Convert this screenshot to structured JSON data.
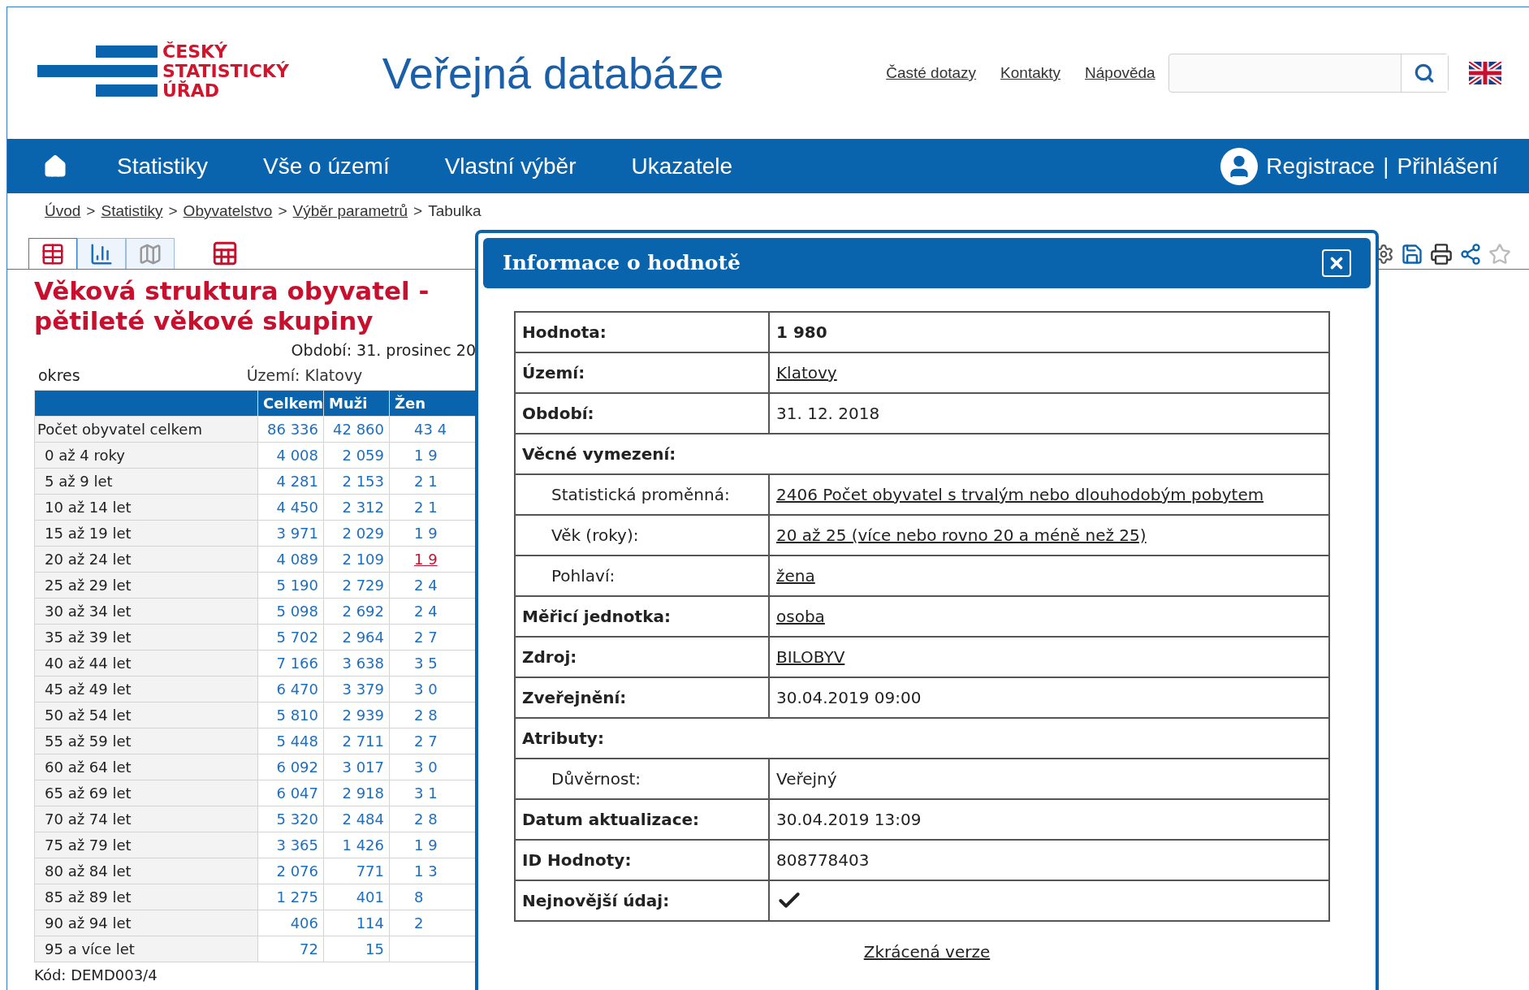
{
  "logo": {
    "lines": [
      "ČESKÝ",
      "STATISTICKÝ",
      "ÚŘAD"
    ]
  },
  "site_title": "Veřejná databáze",
  "top_links": [
    "Časté dotazy",
    "Kontakty",
    "Nápověda"
  ],
  "nav": {
    "items": [
      "Statistiky",
      "Vše o území",
      "Vlastní výběr",
      "Ukazatele"
    ],
    "account": [
      "Registrace",
      "Přihlášení"
    ],
    "account_separator": "|"
  },
  "breadcrumb": {
    "separator": ">",
    "items": [
      {
        "label": "Úvod",
        "link": true
      },
      {
        "label": "Statistiky",
        "link": true
      },
      {
        "label": "Obyvatelstvo",
        "link": true
      },
      {
        "label": "Výběr parametrů",
        "link": true
      },
      {
        "label": "Tabulka",
        "link": false
      }
    ]
  },
  "view_tabs": [
    {
      "kind": "table",
      "selected": true
    },
    {
      "kind": "chart",
      "selected": false
    },
    {
      "kind": "map",
      "selected": false
    }
  ],
  "report": {
    "title": "Věková struktura obyvatel - pětileté věkové skupiny",
    "period": "Období: 31. prosinec 20",
    "area_label": "okres",
    "area": "Území: Klatovy",
    "columns": [
      "Celkem",
      "Muži",
      "Žen"
    ],
    "rows": [
      {
        "label": "Počet obyvatel celkem",
        "celkem": "86 336",
        "muzi": "42 860",
        "zeny": "43 4",
        "selected": false
      },
      {
        "label": "0 až 4 roky",
        "celkem": "4 008",
        "muzi": "2 059",
        "zeny": "1 9",
        "selected": false
      },
      {
        "label": "5 až 9 let",
        "celkem": "4 281",
        "muzi": "2 153",
        "zeny": "2 1",
        "selected": false
      },
      {
        "label": "10 až 14 let",
        "celkem": "4 450",
        "muzi": "2 312",
        "zeny": "2 1",
        "selected": false
      },
      {
        "label": "15 až 19 let",
        "celkem": "3 971",
        "muzi": "2 029",
        "zeny": "1 9",
        "selected": false
      },
      {
        "label": "20 až 24 let",
        "celkem": "4 089",
        "muzi": "2 109",
        "zeny": "1 9",
        "selected": true
      },
      {
        "label": "25 až 29 let",
        "celkem": "5 190",
        "muzi": "2 729",
        "zeny": "2 4",
        "selected": false
      },
      {
        "label": "30 až 34 let",
        "celkem": "5 098",
        "muzi": "2 692",
        "zeny": "2 4",
        "selected": false
      },
      {
        "label": "35 až 39 let",
        "celkem": "5 702",
        "muzi": "2 964",
        "zeny": "2 7",
        "selected": false
      },
      {
        "label": "40 až 44 let",
        "celkem": "7 166",
        "muzi": "3 638",
        "zeny": "3 5",
        "selected": false
      },
      {
        "label": "45 až 49 let",
        "celkem": "6 470",
        "muzi": "3 379",
        "zeny": "3 0",
        "selected": false
      },
      {
        "label": "50 až 54 let",
        "celkem": "5 810",
        "muzi": "2 939",
        "zeny": "2 8",
        "selected": false
      },
      {
        "label": "55 až 59 let",
        "celkem": "5 448",
        "muzi": "2 711",
        "zeny": "2 7",
        "selected": false
      },
      {
        "label": "60 až 64 let",
        "celkem": "6 092",
        "muzi": "3 017",
        "zeny": "3 0",
        "selected": false
      },
      {
        "label": "65 až 69 let",
        "celkem": "6 047",
        "muzi": "2 918",
        "zeny": "3 1",
        "selected": false
      },
      {
        "label": "70 až 74 let",
        "celkem": "5 320",
        "muzi": "2 484",
        "zeny": "2 8",
        "selected": false
      },
      {
        "label": "75 až 79 let",
        "celkem": "3 365",
        "muzi": "1 426",
        "zeny": "1 9",
        "selected": false
      },
      {
        "label": "80 až 84 let",
        "celkem": "2 076",
        "muzi": "771",
        "zeny": "1 3",
        "selected": false
      },
      {
        "label": "85 až 89 let",
        "celkem": "1 275",
        "muzi": "401",
        "zeny": "8",
        "selected": false
      },
      {
        "label": "90 až 94 let",
        "celkem": "406",
        "muzi": "114",
        "zeny": "2",
        "selected": false
      },
      {
        "label": "95 a více let",
        "celkem": "72",
        "muzi": "15"
      }
    ],
    "code": "Kód: DEMD003/4"
  },
  "dialog": {
    "title": "Informace o hodnotě",
    "rows": [
      {
        "kind": "field",
        "label": "Hodnota:",
        "value": "1 980",
        "link": false,
        "bold": true
      },
      {
        "kind": "field",
        "label": "Území:",
        "value": "Klatovy",
        "link": true,
        "bold": false
      },
      {
        "kind": "field",
        "label": "Období:",
        "value": "31. 12. 2018",
        "link": false,
        "bold": false
      },
      {
        "kind": "section",
        "label": "Věcné vymezení:"
      },
      {
        "kind": "sub",
        "label": "Statistická proměnná:",
        "value": "2406 Počet obyvatel s trvalým nebo dlouhodobým pobytem",
        "link": true,
        "bold": false
      },
      {
        "kind": "sub",
        "label": "Věk (roky):",
        "value": "20 až 25 (více nebo rovno 20 a méně než 25)",
        "link": true,
        "bold": false
      },
      {
        "kind": "sub",
        "label": "Pohlaví:",
        "value": "žena",
        "link": true,
        "bold": false
      },
      {
        "kind": "field",
        "label": "Měřicí jednotka:",
        "value": "osoba",
        "link": true,
        "bold": false
      },
      {
        "kind": "field",
        "label": "Zdroj:",
        "value": "BILOBYV",
        "link": true,
        "bold": false
      },
      {
        "kind": "field",
        "label": "Zveřejnění:",
        "value": "30.04.2019 09:00",
        "link": false,
        "bold": false
      },
      {
        "kind": "section",
        "label": "Atributy:"
      },
      {
        "kind": "sub",
        "label": "Důvěrnost:",
        "value": "Veřejný",
        "link": false,
        "bold": false
      },
      {
        "kind": "field",
        "label": "Datum aktualizace:",
        "value": "30.04.2019 13:09",
        "link": false,
        "bold": false
      },
      {
        "kind": "field",
        "label": "ID Hodnoty:",
        "value": "808778403",
        "link": false,
        "bold": false
      },
      {
        "kind": "check",
        "label": "Nejnovější údaj:",
        "checked": true
      }
    ],
    "footer_link": "Zkrácená verze"
  }
}
